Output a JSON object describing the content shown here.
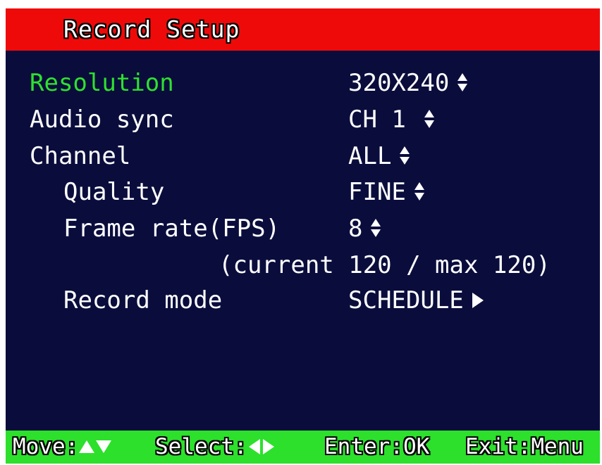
{
  "title": "Record Setup",
  "colors": {
    "header": "#ef0a0a",
    "background": "#0a0d3c",
    "footer": "#2ce02c",
    "selected": "#2fe02f"
  },
  "settings": [
    {
      "label": "Resolution",
      "value": "320X240",
      "control": "up-down-arrows-icon"
    },
    {
      "label": "Audio sync",
      "value": "CH 1",
      "control": "up-down-arrows-icon"
    },
    {
      "label": "Channel",
      "value": "ALL",
      "control": "up-down-arrows-icon"
    },
    {
      "label": "Quality",
      "value": "FINE",
      "control": "up-down-arrows-icon"
    },
    {
      "label": "Frame rate(FPS)",
      "value": "8",
      "control": "up-down-arrows-icon"
    },
    {
      "label": "Record mode",
      "value": "SCHEDULE",
      "control": "right-arrow-icon"
    }
  ],
  "fps_info": "(current 120 / max 120)",
  "footer": {
    "move": "Move:",
    "select": "Select:",
    "enter": "Enter:OK",
    "exit": "Exit:Menu"
  }
}
